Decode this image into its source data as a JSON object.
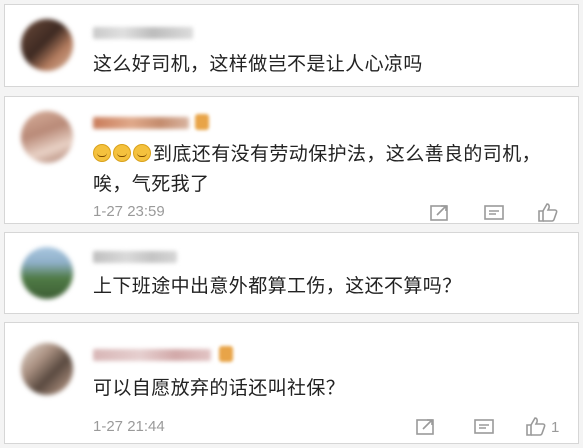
{
  "comments": [
    {
      "text": "这么好司机，这样做岂不是让人心凉吗",
      "time": "",
      "likes": ""
    },
    {
      "text": "到底还有没有劳动保护法，这么善良的司机，唉，气死我了",
      "time": "1-27 23:59",
      "likes": ""
    },
    {
      "text": "上下班途中出意外都算工伤，这还不算吗？",
      "time": "",
      "likes": ""
    },
    {
      "text": "可以自愿放弃的话还叫社保？",
      "time": "1-27 21:44",
      "likes": "1"
    }
  ],
  "icons": {
    "share": "share-icon",
    "comment": "comment-icon",
    "like": "like-icon",
    "emoji": "grin-emoji-icon"
  }
}
